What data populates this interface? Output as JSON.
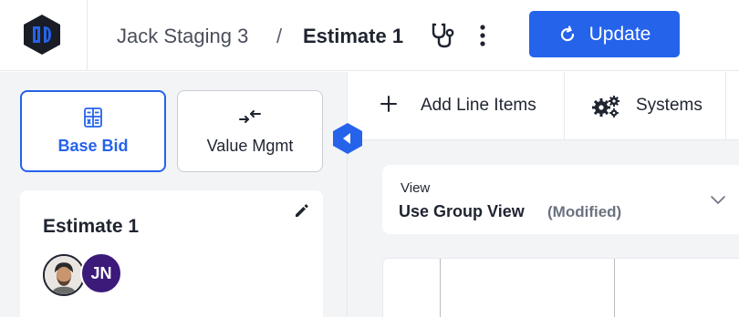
{
  "header": {
    "breadcrumb_parent": "Jack Staging 3",
    "breadcrumb_separator": "/",
    "breadcrumb_current": "Estimate 1",
    "update_label": "Update",
    "accent_color": "#2563eb"
  },
  "icons": {
    "logo": "logo-icon",
    "diagnostics": "stethoscope-icon",
    "more": "kebab-icon",
    "refresh": "refresh-icon"
  },
  "sidebar": {
    "tabs": [
      {
        "label": "Base Bid",
        "icon": "calculator-icon",
        "active": true
      },
      {
        "label": "Value Mgmt",
        "icon": "arrows-in-icon",
        "active": false
      }
    ],
    "estimate_card": {
      "title": "Estimate 1",
      "avatars": [
        {
          "type": "photo"
        },
        {
          "initials": "JN",
          "color": "#3b1a7a"
        }
      ]
    }
  },
  "toolbar": {
    "add_line_items_label": "Add Line Items",
    "systems_label": "Systems"
  },
  "view_selector": {
    "label": "View",
    "value": "Use Group View",
    "modified": "(Modified)"
  }
}
